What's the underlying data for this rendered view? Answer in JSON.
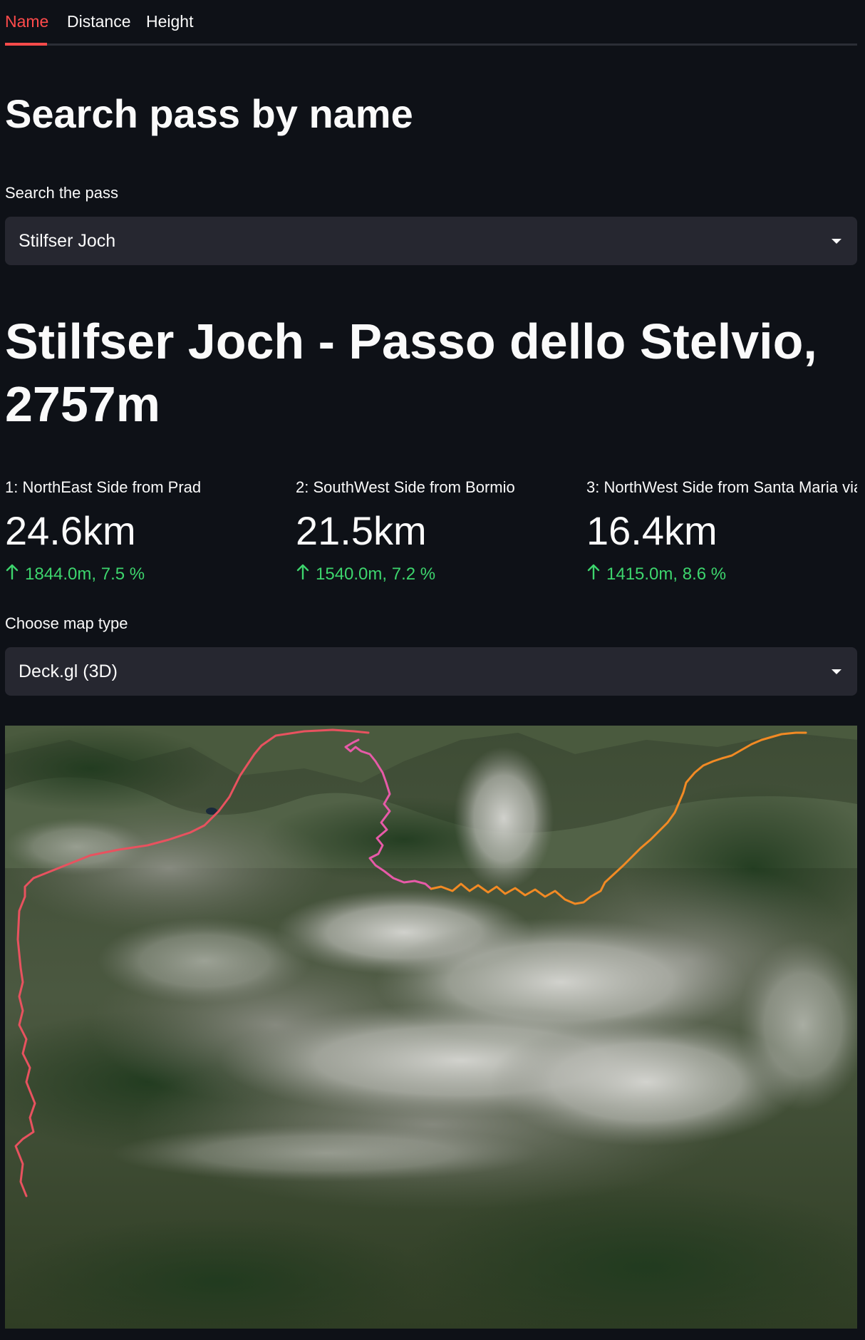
{
  "tabs": [
    {
      "label": "Name",
      "active": true
    },
    {
      "label": "Distance",
      "active": false
    },
    {
      "label": "Height",
      "active": false
    }
  ],
  "page_title": "Search pass by name",
  "search": {
    "label": "Search the pass",
    "value": "Stilfser Joch"
  },
  "pass_title": "Stilfser Joch - Passo dello Stelvio, 2757m",
  "metrics": [
    {
      "label": "1: NorthEast Side from Prad",
      "value": "24.6km",
      "delta": "1844.0m, 7.5 %"
    },
    {
      "label": "2: SouthWest Side from Bormio",
      "value": "21.5km",
      "delta": "1540.0m, 7.2 %"
    },
    {
      "label": "3: NorthWest Side from Santa Maria via",
      "value": "16.4km",
      "delta": "1415.0m, 8.6 %"
    }
  ],
  "map_type": {
    "label": "Choose map type",
    "value": "Deck.gl (3D)"
  },
  "colors": {
    "accent": "#ff4b4b",
    "delta_positive": "#3dd56d",
    "route_1": "#e8525f",
    "route_2": "#e75aa8",
    "route_3": "#f28a24"
  },
  "icons": {
    "delta": "arrow-up-icon",
    "select": "chevron-down-icon"
  }
}
